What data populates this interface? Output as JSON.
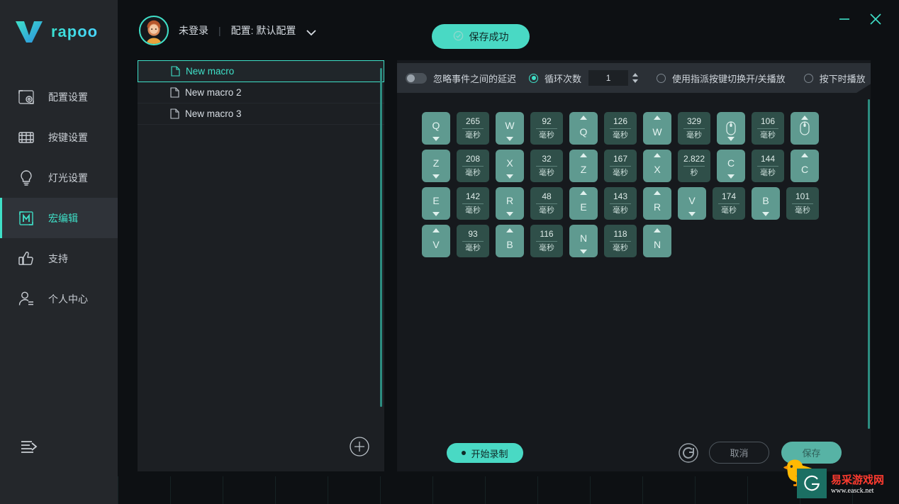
{
  "brand": {
    "name": "rapoo"
  },
  "titlebar": {
    "minimize_label": "–",
    "close_label": "×"
  },
  "sidebar": {
    "items": [
      {
        "label": "配置设置",
        "icon": "profile-settings-icon",
        "active": false
      },
      {
        "label": "按键设置",
        "icon": "key-settings-icon",
        "active": false
      },
      {
        "label": "灯光设置",
        "icon": "lighting-settings-icon",
        "active": false
      },
      {
        "label": "宏编辑",
        "icon": "macro-editor-icon",
        "active": true
      },
      {
        "label": "支持",
        "icon": "thumbs-up-icon",
        "active": false
      },
      {
        "label": "个人中心",
        "icon": "user-center-icon",
        "active": false
      }
    ],
    "collapse_icon": "collapse-sidebar-icon"
  },
  "header": {
    "user_status": "未登录",
    "divider": "|",
    "profile_label": "配置: 默认配置",
    "chevron_icon": "chevron-down-icon",
    "avatar_icon": "user-avatar"
  },
  "toast": {
    "text": "保存成功",
    "icon": "check-circle-icon"
  },
  "macro_list": {
    "items": [
      {
        "name": "New macro",
        "selected": true
      },
      {
        "name": "New macro 2",
        "selected": false
      },
      {
        "name": "New macro 3",
        "selected": false
      }
    ],
    "add_label": "+",
    "add_icon": "plus-circle-icon"
  },
  "options": {
    "ignore_delay_label": "忽略事件之间的延迟",
    "ignore_delay_on": false,
    "loop_count_label": "循环次数",
    "loop_count_selected": true,
    "loop_count_value": "1",
    "toggle_key_label": "使用指派按键切换开/关播放",
    "toggle_key_selected": false,
    "hold_play_label": "按下时播放",
    "hold_play_selected": false
  },
  "sequence": {
    "rows": [
      [
        {
          "kind": "key",
          "label": "Q",
          "dir": "down"
        },
        {
          "kind": "delay",
          "value": "265",
          "unit": "毫秒"
        },
        {
          "kind": "key",
          "label": "W",
          "dir": "down"
        },
        {
          "kind": "delay",
          "value": "92",
          "unit": "毫秒"
        },
        {
          "kind": "key",
          "label": "Q",
          "dir": "up"
        },
        {
          "kind": "delay",
          "value": "126",
          "unit": "毫秒"
        },
        {
          "kind": "key",
          "label": "W",
          "dir": "up"
        },
        {
          "kind": "delay",
          "value": "329",
          "unit": "毫秒"
        },
        {
          "kind": "mouse",
          "label": "",
          "dir": "down"
        },
        {
          "kind": "delay",
          "value": "106",
          "unit": "毫秒"
        },
        {
          "kind": "mouse",
          "label": "",
          "dir": "up"
        }
      ],
      [
        {
          "kind": "key",
          "label": "Z",
          "dir": "down"
        },
        {
          "kind": "delay",
          "value": "208",
          "unit": "毫秒"
        },
        {
          "kind": "key",
          "label": "X",
          "dir": "down"
        },
        {
          "kind": "delay",
          "value": "32",
          "unit": "毫秒"
        },
        {
          "kind": "key",
          "label": "Z",
          "dir": "up"
        },
        {
          "kind": "delay",
          "value": "167",
          "unit": "毫秒"
        },
        {
          "kind": "key",
          "label": "X",
          "dir": "up"
        },
        {
          "kind": "delay",
          "value": "2.822",
          "unit": "秒"
        },
        {
          "kind": "key",
          "label": "C",
          "dir": "down"
        },
        {
          "kind": "delay",
          "value": "144",
          "unit": "毫秒"
        },
        {
          "kind": "key",
          "label": "C",
          "dir": "up"
        }
      ],
      [
        {
          "kind": "key",
          "label": "E",
          "dir": "down"
        },
        {
          "kind": "delay",
          "value": "142",
          "unit": "毫秒"
        },
        {
          "kind": "key",
          "label": "R",
          "dir": "down"
        },
        {
          "kind": "delay",
          "value": "48",
          "unit": "毫秒"
        },
        {
          "kind": "key",
          "label": "E",
          "dir": "up"
        },
        {
          "kind": "delay",
          "value": "143",
          "unit": "毫秒"
        },
        {
          "kind": "key",
          "label": "R",
          "dir": "up"
        },
        {
          "kind": "key",
          "label": "V",
          "dir": "down"
        },
        {
          "kind": "delay",
          "value": "174",
          "unit": "毫秒"
        },
        {
          "kind": "key",
          "label": "B",
          "dir": "down"
        },
        {
          "kind": "delay",
          "value": "101",
          "unit": "毫秒"
        }
      ],
      [
        {
          "kind": "key",
          "label": "V",
          "dir": "up"
        },
        {
          "kind": "delay",
          "value": "93",
          "unit": "毫秒"
        },
        {
          "kind": "key",
          "label": "B",
          "dir": "up"
        },
        {
          "kind": "delay",
          "value": "116",
          "unit": "毫秒"
        },
        {
          "kind": "key",
          "label": "N",
          "dir": "down"
        },
        {
          "kind": "delay",
          "value": "118",
          "unit": "毫秒"
        },
        {
          "kind": "key",
          "label": "N",
          "dir": "up"
        }
      ]
    ]
  },
  "footer": {
    "record_label": "开始录制",
    "reset_icon": "reset-icon",
    "cancel_label": "取消",
    "save_label": "保存"
  },
  "watermark": {
    "title": "易采游戏网",
    "url": "www.easck.net",
    "badge_icon": "easck-logo-icon"
  },
  "colors": {
    "accent": "#3fe0c8",
    "accent_solid": "#49d9c4",
    "key_tile": "#5f9a90",
    "delay_tile": "#2f4f49",
    "sidebar_bg": "#24272b",
    "panel_bg": "#1c1f23",
    "right_panel_bg": "#16191d"
  }
}
